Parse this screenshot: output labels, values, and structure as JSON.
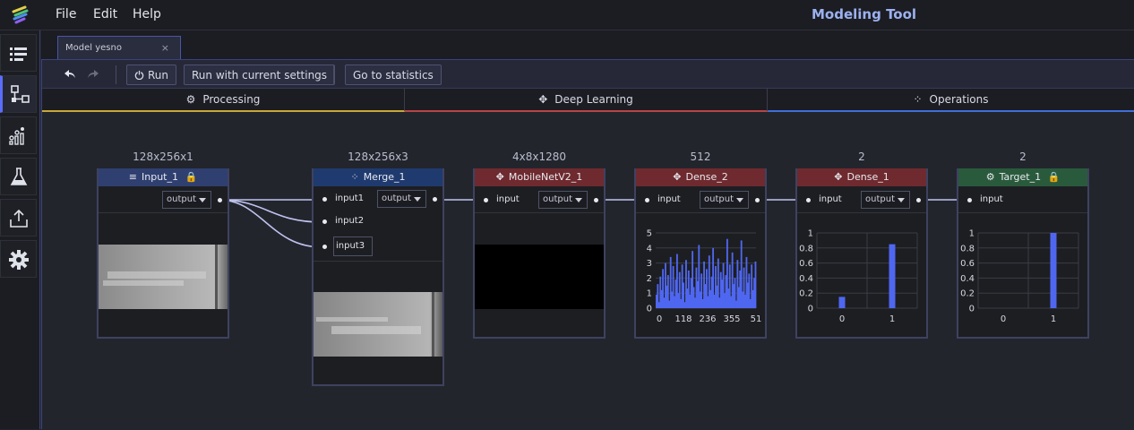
{
  "menu": {
    "file": "File",
    "edit": "Edit",
    "help": "Help"
  },
  "app_title": "Modeling Tool",
  "document_tab": {
    "label": "Model yesno",
    "close": "×"
  },
  "toolbar": {
    "run": "Run",
    "run_current": "Run with current settings",
    "go_stats": "Go to statistics"
  },
  "category_tabs": [
    {
      "label": "Processing",
      "color": "#c9a83a"
    },
    {
      "label": "Deep Learning",
      "color": "#b84545"
    },
    {
      "label": "Operations",
      "color": "#3f6fd8"
    }
  ],
  "colors": {
    "accent": "#5b6cff",
    "input_header": "#2f3f70",
    "merge_header": "#1f3a6e",
    "deep_header": "#6e2a2e",
    "target_header": "#2a5a3c",
    "bar": "#4f67f0",
    "wire": "#bfc3ee"
  },
  "nodes": {
    "input": {
      "shape": "128x256x1",
      "title": "Input_1",
      "output": "output"
    },
    "merge": {
      "shape": "128x256x3",
      "title": "Merge_1",
      "inputs": [
        "input1",
        "input2",
        "input3"
      ],
      "output": "output"
    },
    "mobilenet": {
      "shape": "4x8x1280",
      "title": "MobileNetV2_1",
      "input": "input",
      "output": "output"
    },
    "dense2": {
      "shape": "512",
      "title": "Dense_2",
      "input": "input",
      "output": "output"
    },
    "dense1": {
      "shape": "2",
      "title": "Dense_1",
      "input": "input",
      "output": "output"
    },
    "target": {
      "shape": "2",
      "title": "Target_1",
      "input": "input"
    }
  },
  "chart_data": [
    {
      "type": "bar",
      "node": "Dense_2",
      "x_tick_labels": [
        "0",
        "118",
        "236",
        "355",
        "51"
      ],
      "y_tick_labels": [
        "0",
        "1",
        "2",
        "3",
        "4",
        "5"
      ],
      "ylim": [
        0,
        5
      ],
      "values": [
        0.9,
        1.6,
        0.4,
        2.1,
        1.2,
        2.6,
        0.7,
        3.0,
        1.5,
        2.2,
        0.5,
        3.4,
        1.1,
        2.8,
        0.8,
        1.9,
        3.6,
        1.0,
        2.4,
        0.6,
        2.9,
        1.7,
        0.4,
        3.2,
        1.3,
        2.5,
        0.9,
        2.0,
        3.8,
        1.4,
        0.7,
        2.7,
        1.8,
        4.2,
        1.1,
        2.3,
        0.6,
        3.1,
        1.6,
        2.6,
        0.8,
        3.5,
        1.2,
        2.1,
        4.0,
        0.9,
        2.8,
        1.5,
        3.3,
        0.7,
        2.4,
        1.9,
        3.0,
        1.0,
        2.2,
        4.6,
        1.3,
        2.9,
        0.8,
        3.7,
        1.6,
        2.0,
        0.5,
        3.2,
        1.4,
        2.5,
        4.5,
        1.1,
        2.7,
        0.9,
        3.4,
        1.7,
        2.3,
        0.6,
        2.9,
        1.2,
        2.0,
        3.1
      ]
    },
    {
      "type": "bar",
      "node": "Dense_1",
      "categories": [
        "0",
        "1"
      ],
      "values": [
        0.15,
        0.85
      ],
      "y_tick_labels": [
        "0",
        "0.2",
        "0.4",
        "0.6",
        "0.8",
        "1"
      ],
      "ylim": [
        0,
        1
      ]
    },
    {
      "type": "bar",
      "node": "Target_1",
      "categories": [
        "0",
        "1"
      ],
      "values": [
        0,
        1
      ],
      "y_tick_labels": [
        "0",
        "0.2",
        "0.4",
        "0.6",
        "0.8",
        "1"
      ],
      "ylim": [
        0,
        1
      ]
    }
  ]
}
